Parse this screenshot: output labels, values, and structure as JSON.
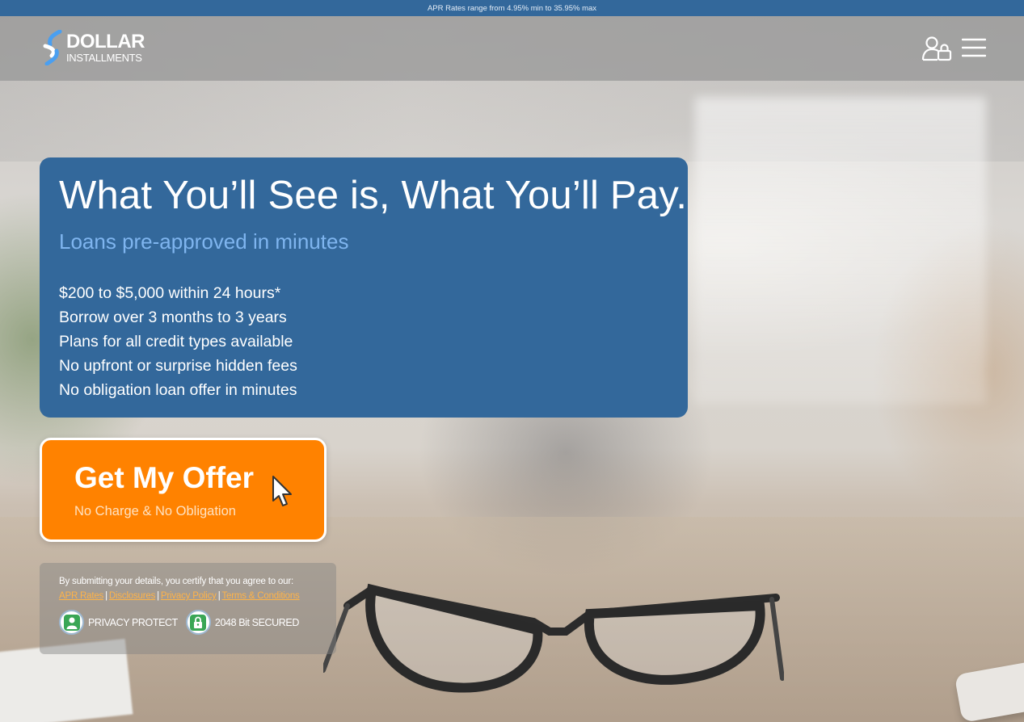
{
  "banner": {
    "text": "APR Rates range from 4.95% min to 35.95% max"
  },
  "header": {
    "logo_line1": "DOLLAR",
    "logo_line2": "INSTALLMENTS",
    "account_icon": "user-lock-icon",
    "menu_icon": "hamburger-menu-icon"
  },
  "hero": {
    "title": "What You’ll See is, What You’ll Pay.",
    "subtitle": "Loans pre-approved in minutes",
    "features": [
      "$200 to $5,000 within 24 hours*",
      "Borrow over 3 months to 3 years",
      "Plans for all credit types available",
      "No upfront or surprise hidden fees",
      "No obligation loan offer in minutes"
    ]
  },
  "cta": {
    "title": "Get My Offer",
    "subtitle": "No Charge & No Obligation",
    "icon": "pointer-cursor-icon"
  },
  "consent": {
    "text": "By submitting your details, you certify that you agree to our:",
    "links": [
      "APR Rates",
      "Disclosures",
      "Privacy Policy",
      "Terms & Conditions"
    ],
    "separator": "|",
    "badges": [
      {
        "label": "PRIVACY PROTECT",
        "icon": "person-icon"
      },
      {
        "label": "2048 Bit SECURED",
        "icon": "padlock-icon"
      }
    ]
  },
  "colors": {
    "primary_blue": "#33689b",
    "accent_light_blue": "#7fb5ef",
    "cta_orange": "#ff8200",
    "link_orange": "#ffb347",
    "badge_green": "#3aa655"
  }
}
